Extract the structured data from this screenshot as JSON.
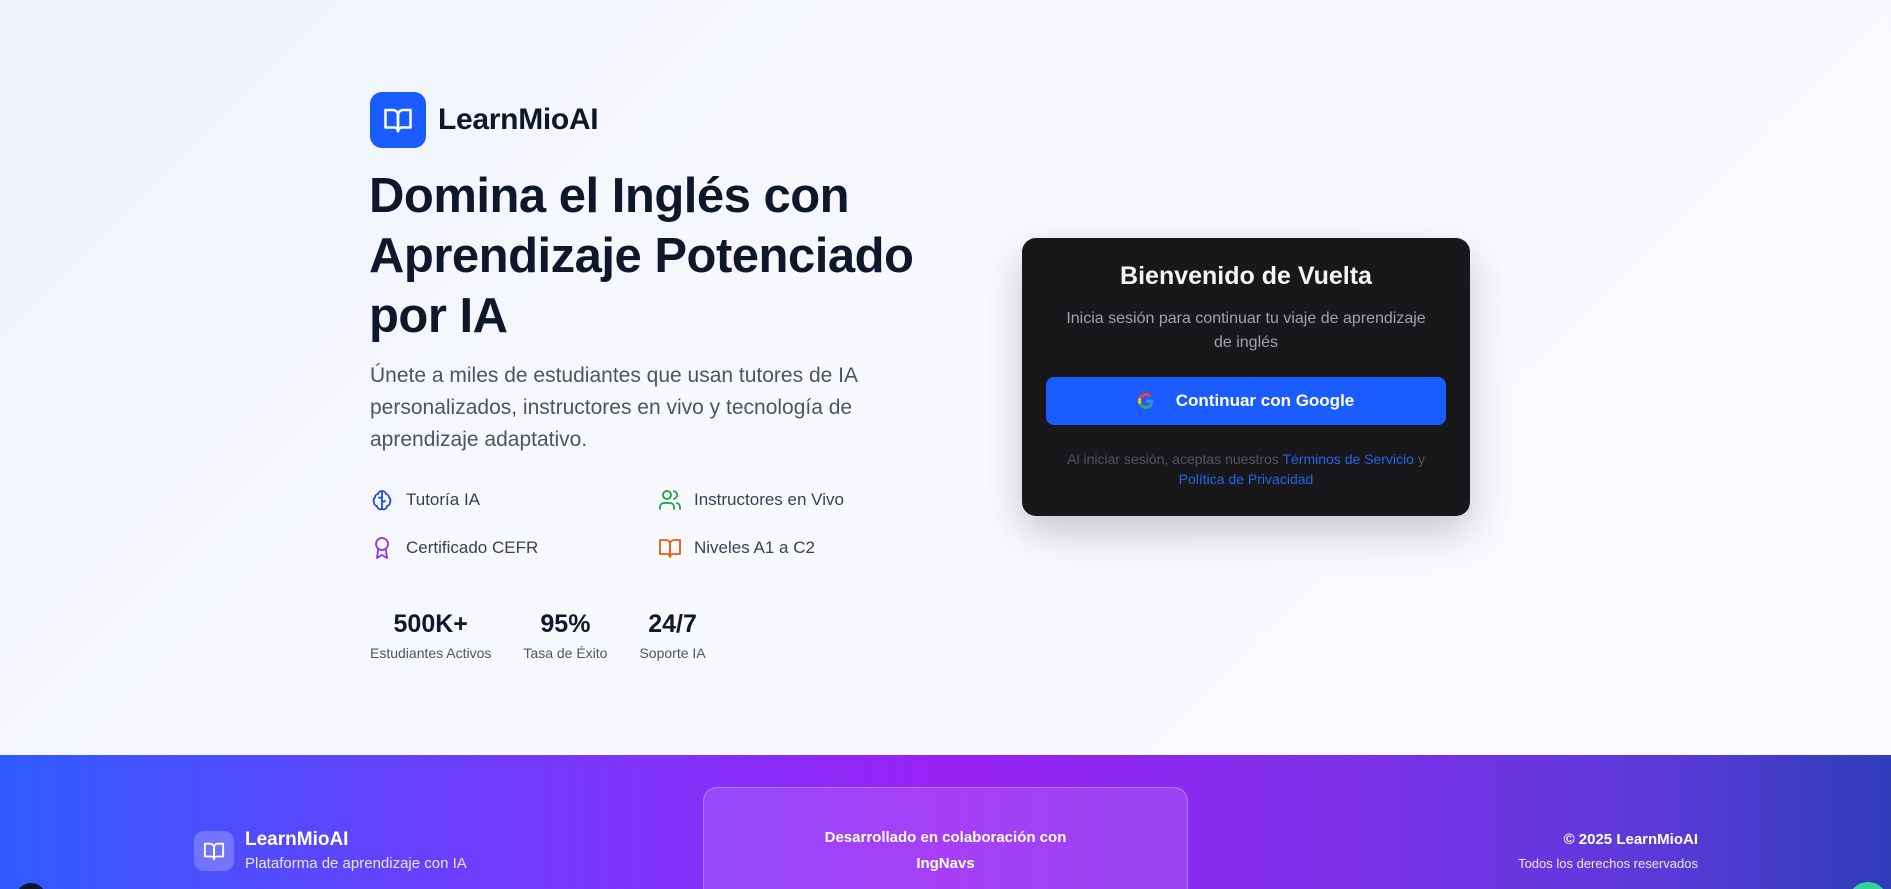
{
  "brand": {
    "name": "LearnMioAI"
  },
  "hero": {
    "headline": "Domina el Inglés con Aprendizaje Potenciado por IA",
    "subtext": "Únete a miles de estudiantes que usan tutores de IA personalizados, instructores en vivo y tecnología de aprendizaje adaptativo."
  },
  "features": [
    {
      "label": "Tutoría IA",
      "icon": "brain-icon",
      "color": "#1d4ed8"
    },
    {
      "label": "Instructores en Vivo",
      "icon": "users-icon",
      "color": "#16a34a"
    },
    {
      "label": "Certificado CEFR",
      "icon": "award-icon",
      "color": "#9333ea"
    },
    {
      "label": "Niveles A1 a C2",
      "icon": "book-open-icon",
      "color": "#ea580c"
    }
  ],
  "stats": [
    {
      "value": "500K+",
      "label": "Estudiantes Activos"
    },
    {
      "value": "95%",
      "label": "Tasa de Éxito"
    },
    {
      "value": "24/7",
      "label": "Soporte IA"
    }
  ],
  "login": {
    "title": "Bienvenido de Vuelta",
    "subtitle": "Inicia sesión para continuar tu viaje de aprendizaje de inglés",
    "google_button": "Continuar con Google",
    "legal_prefix": "Al iniciar sesión, aceptas nuestros",
    "terms_link": "Términos de Servicio",
    "legal_and": "y",
    "privacy_link": "Política de Privacidad"
  },
  "footer": {
    "brand_name": "LearnMioAI",
    "tagline": "Plataforma de aprendizaje con IA",
    "collab_line": "Desarrollado en colaboración con",
    "collab_name": "IngNavs",
    "copyright": "© 2025 LearnMioAI",
    "rights": "Todos los derechos reservados"
  },
  "colors": {
    "accent": "#1a5cff",
    "card_bg": "#18181b",
    "footer_gradient": [
      "#2f5bff",
      "#9a22f5",
      "#2f3db8"
    ]
  }
}
